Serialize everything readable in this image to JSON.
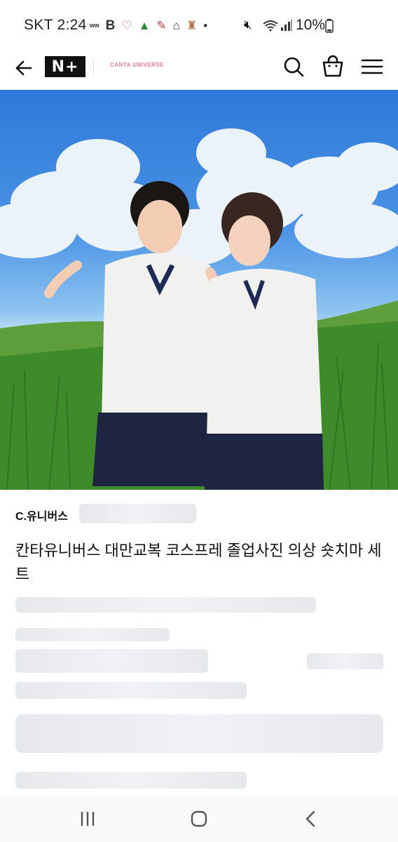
{
  "status_bar": {
    "time": "SKT 2:24",
    "battery": "10%",
    "notif_letter": "B"
  },
  "header": {
    "logo": "N+",
    "brand": "CANTA UNIVERSE",
    "accent": "#f07aa0",
    "icons": [
      "back-arrow-icon",
      "search-icon",
      "shopping-bag-icon",
      "menu-icon"
    ]
  },
  "product": {
    "seller": "C.유니버스",
    "title": "칸타유니버스 대만교복 코스프레 졸업사진 의상 숏치마 세트"
  },
  "nav": {
    "icons": [
      "recent-apps-icon",
      "home-icon",
      "back-icon"
    ]
  }
}
